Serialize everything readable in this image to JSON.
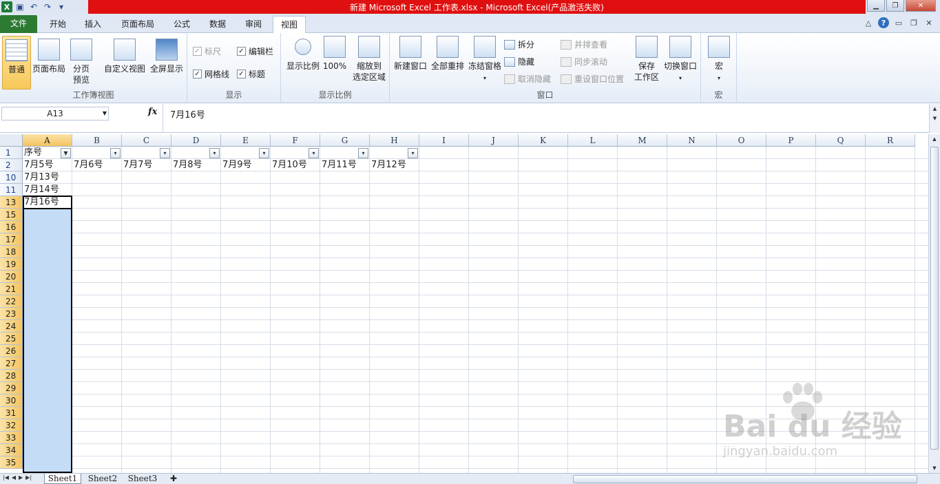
{
  "window": {
    "title": "新建 Microsoft Excel 工作表.xlsx - Microsoft Excel(产品激活失败)",
    "controls": [
      "minimize",
      "restore",
      "close"
    ]
  },
  "ribbon_tabs": [
    "文件",
    "开始",
    "插入",
    "页面布局",
    "公式",
    "数据",
    "审阅",
    "视图"
  ],
  "active_tab": "视图",
  "ribbon": {
    "workbook_views": {
      "label": "工作簿视图",
      "buttons": [
        "普通",
        "页面布局",
        "分页",
        "预览",
        "自定义视图",
        "全屏显示"
      ]
    },
    "show": {
      "label": "显示",
      "checks": [
        {
          "label": "标尺",
          "checked": true,
          "disabled": true
        },
        {
          "label": "编辑栏",
          "checked": true,
          "disabled": false
        },
        {
          "label": "网格线",
          "checked": true,
          "disabled": false
        },
        {
          "label": "标题",
          "checked": true,
          "disabled": false
        }
      ]
    },
    "zoom": {
      "label": "显示比例",
      "buttons": [
        "显示比例",
        "100%",
        "缩放到",
        "选定区域"
      ]
    },
    "window": {
      "label": "窗口",
      "big": [
        "新建窗口",
        "全部重排",
        "冻结窗格"
      ],
      "small": [
        "拆分",
        "隐藏",
        "取消隐藏",
        "并排查看",
        "同步滚动",
        "重设窗口位置"
      ],
      "save": [
        "保存",
        "工作区"
      ],
      "switch": "切换窗口"
    },
    "macro": {
      "label": "宏",
      "button": "宏"
    }
  },
  "formula_bar": {
    "name_box": "A13",
    "fx": "fx",
    "value": "7月16号"
  },
  "columns": [
    "A",
    "B",
    "C",
    "D",
    "E",
    "F",
    "G",
    "H",
    "I",
    "J",
    "K",
    "L",
    "M",
    "N",
    "O",
    "P",
    "Q",
    "R"
  ],
  "selected_column": "A",
  "rows": [
    "1",
    "2",
    "10",
    "11",
    "13",
    "15",
    "16",
    "17",
    "18",
    "19",
    "20",
    "21",
    "22",
    "23",
    "24",
    "25",
    "26",
    "27",
    "28",
    "29",
    "30",
    "31",
    "32",
    "33",
    "34",
    "35"
  ],
  "cells": {
    "A1": "序号",
    "A2": "7月5号",
    "B2": "7月6号",
    "C2": "7月7号",
    "D2": "7月8号",
    "E2": "7月9号",
    "F2": "7月10号",
    "G2": "7月11号",
    "H2": "7月12号",
    "A10": "7月13号",
    "A11": "7月14号",
    "A13": "7月16号"
  },
  "sheets": [
    "Sheet1",
    "Sheet2",
    "Sheet3"
  ],
  "active_sheet": "Sheet1",
  "watermark": {
    "brand": "Bai du 经验",
    "url": "jingyan.baidu.com"
  }
}
